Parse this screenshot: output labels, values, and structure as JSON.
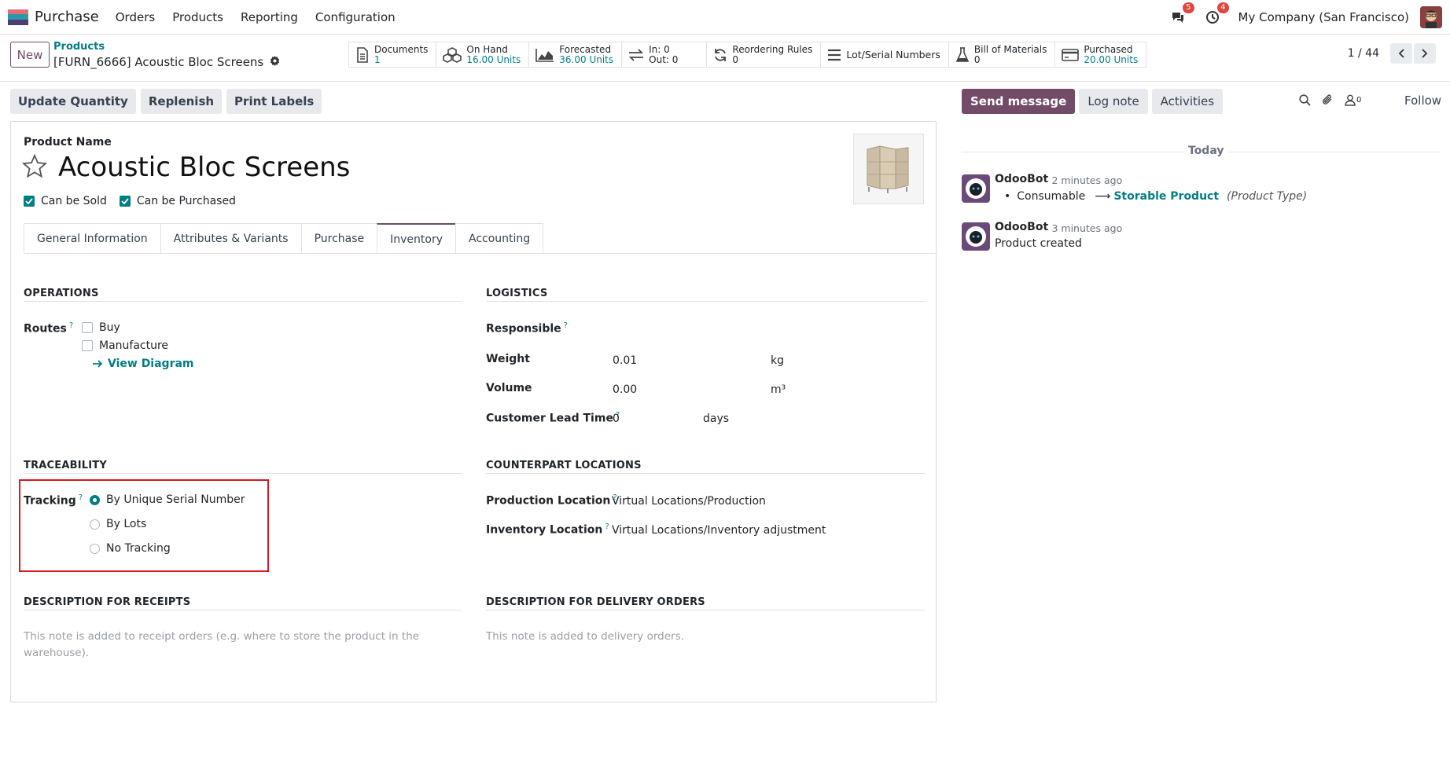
{
  "navbar": {
    "app_name": "Purchase",
    "menu": [
      "Orders",
      "Products",
      "Reporting",
      "Configuration"
    ],
    "messages_badge": "5",
    "activities_badge": "4",
    "company": "My Company (San Francisco)"
  },
  "control": {
    "new_label": "New",
    "breadcrumb": "Products",
    "record": "[FURN_6666] Acoustic Bloc Screens",
    "pager": "1 / 44"
  },
  "smart": {
    "documents": {
      "title": "Documents",
      "value": "1"
    },
    "on_hand": {
      "title": "On Hand",
      "value": "16.00 Units"
    },
    "forecasted": {
      "title": "Forecasted",
      "value": "36.00 Units"
    },
    "in_out": {
      "title": "In: 0",
      "value": "Out: 0"
    },
    "reordering": {
      "title": "Reordering Rules",
      "value": "0"
    },
    "lots": {
      "title": "Lot/Serial Numbers"
    },
    "bom": {
      "title": "Bill of Materials",
      "value": "0"
    },
    "purchased": {
      "title": "Purchased",
      "value": "20.00 Units"
    }
  },
  "actions": [
    "Update Quantity",
    "Replenish",
    "Print Labels"
  ],
  "product": {
    "name_label": "Product Name",
    "name": "Acoustic Bloc Screens",
    "can_be_sold": "Can be Sold",
    "can_be_purchased": "Can be Purchased"
  },
  "tabs": [
    "General Information",
    "Attributes & Variants",
    "Purchase",
    "Inventory",
    "Accounting"
  ],
  "active_tab": "Inventory",
  "operations": {
    "title": "OPERATIONS",
    "routes_label": "Routes",
    "help": "?",
    "routes": [
      "Buy",
      "Manufacture"
    ],
    "view_diagram": "View Diagram"
  },
  "logistics": {
    "title": "LOGISTICS",
    "responsible_label": "Responsible",
    "weight_label": "Weight",
    "weight_value": "0.01",
    "weight_unit": "kg",
    "volume_label": "Volume",
    "volume_value": "0.00",
    "volume_unit": "m³",
    "lead_label": "Customer Lead Time",
    "lead_value": "0",
    "lead_unit": "days"
  },
  "traceability": {
    "title": "TRACEABILITY",
    "tracking_label": "Tracking",
    "options": [
      "By Unique Serial Number",
      "By Lots",
      "No Tracking"
    ],
    "selected": "By Unique Serial Number"
  },
  "counterpart": {
    "title": "COUNTERPART LOCATIONS",
    "production_label": "Production Location",
    "production_value": "Virtual Locations/Production",
    "inventory_label": "Inventory Location",
    "inventory_value": "Virtual Locations/Inventory adjustment"
  },
  "receipts": {
    "title": "DESCRIPTION FOR RECEIPTS",
    "placeholder_1": "This note is added to receipt orders (e.g. where to store the product in the",
    "placeholder_2": "warehouse)."
  },
  "delivery": {
    "title": "DESCRIPTION FOR DELIVERY ORDERS",
    "placeholder": "This note is added to delivery orders."
  },
  "chatter": {
    "send_message": "Send message",
    "log_note": "Log note",
    "activities": "Activities",
    "followers_count": "0",
    "follow": "Follow",
    "today": "Today",
    "messages": [
      {
        "author": "OdooBot",
        "time": "- 2 minutes ago",
        "old": "Consumable",
        "arrow": "⟶",
        "new": "Storable Product",
        "field": "(Product Type)"
      },
      {
        "author": "OdooBot",
        "time": "- 3 minutes ago",
        "body": "Product created"
      }
    ]
  },
  "colors": {
    "brand": "#714b67",
    "accent": "#017e84",
    "highlight": "#d71920"
  }
}
